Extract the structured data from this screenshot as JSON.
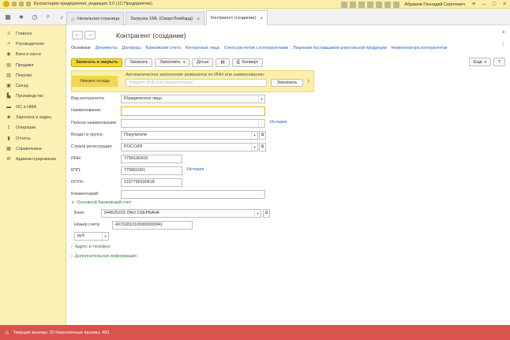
{
  "window": {
    "title": "Бухгалтерия предприятия, редакция 3.0 (1С:Предприятие)",
    "user": "Абрамов Геннадий Сергеевич"
  },
  "open_tabs": [
    {
      "label": "Начальная страница"
    },
    {
      "label": "Загрузка XML (СмартЛомбард)"
    },
    {
      "label": "Контрагент (создание)"
    }
  ],
  "sidebar": {
    "items": [
      {
        "label": "Главное",
        "icon": "list-icon"
      },
      {
        "label": "Руководителю",
        "icon": "chart-icon"
      },
      {
        "label": "Банк и касса",
        "icon": "bank-icon"
      },
      {
        "label": "Продажи",
        "icon": "sales-icon"
      },
      {
        "label": "Покупки",
        "icon": "cart-icon"
      },
      {
        "label": "Склад",
        "icon": "warehouse-icon"
      },
      {
        "label": "Производство",
        "icon": "factory-icon"
      },
      {
        "label": "ОС и НМА",
        "icon": "asset-icon"
      },
      {
        "label": "Зарплата и кадры",
        "icon": "person-icon"
      },
      {
        "label": "Операции",
        "icon": "operations-icon"
      },
      {
        "label": "Отчеты",
        "icon": "reports-icon"
      },
      {
        "label": "Справочники",
        "icon": "catalog-icon"
      },
      {
        "label": "Администрирование",
        "icon": "gear-icon"
      }
    ]
  },
  "form": {
    "title": "Контрагент (создание)",
    "tabs": [
      {
        "label": "Основное"
      },
      {
        "label": "Документы"
      },
      {
        "label": "Договоры"
      },
      {
        "label": "Банковские счета"
      },
      {
        "label": "Контактные лица"
      },
      {
        "label": "Счета расчетов с контрагентами"
      },
      {
        "label": "Лицензии поставщиков алкогольной продукции"
      },
      {
        "label": "Номенклатура контрагентов"
      }
    ],
    "commands": {
      "save_close": "Записать и закрыть",
      "save": "Записать",
      "fill": "Заполнить",
      "dossier": "Досье",
      "envelope": "Конверт",
      "more": "Еще",
      "help": "?"
    },
    "autofill": {
      "badge": "Начните отсюда",
      "hint": "Автоматическое заполнение реквизитов по ИНН или наименованию:",
      "placeholder": "Введите ИНН или Наименование",
      "button": "Заполнить",
      "help": "?"
    },
    "fields": {
      "kind_label": "Вид контрагента:",
      "kind_value": "Юридическое лицо",
      "name_label": "Наименование:",
      "name_value": "",
      "fullname_label": "Полное наименование:",
      "fullname_value": "",
      "history_link": "История",
      "group_label": "Входит в группу:",
      "group_value": "Покупатели",
      "country_label": "Страна регистрации:",
      "country_value": "РОССИЯ",
      "inn_label": "ИНН:",
      "inn_value": "7799100418",
      "kpp_label": "КПП:",
      "kpp_value": "779901001",
      "kpp_history": "История",
      "ogrn_label": "ОГРН:",
      "ogrn_value": "1197799100418",
      "comment_label": "Комментарий:",
      "comment_value": ""
    },
    "bank": {
      "section": "Основной банковский счет",
      "bank_label": "Банк:",
      "bank_value": "044525225 ПАО СБЕРБАНК",
      "account_label": "Номер счета:",
      "account_value": "40702810100000000041",
      "currency_value": "руб."
    },
    "sections": {
      "address": "Адрес и телефон",
      "extra": "Дополнительная информация"
    }
  },
  "status": {
    "text": "Текущие вызовы: 20   Накопленные вызовы: 493"
  }
}
